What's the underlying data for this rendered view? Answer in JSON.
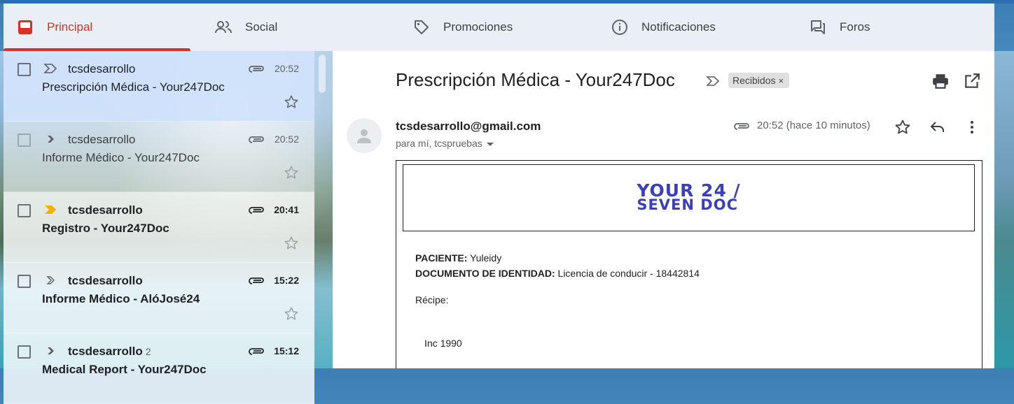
{
  "tabs": [
    {
      "label": "Principal",
      "icon": "inbox-icon",
      "active": true
    },
    {
      "label": "Social",
      "icon": "people-icon",
      "active": false
    },
    {
      "label": "Promociones",
      "icon": "tag-icon",
      "active": false
    },
    {
      "label": "Notificaciones",
      "icon": "info-icon",
      "active": false
    },
    {
      "label": "Foros",
      "icon": "forum-icon",
      "active": false
    }
  ],
  "mail_list": [
    {
      "sender": "tcsdesarrollo",
      "count": "",
      "time": "20:52",
      "subject": "Prescripción Médica - Your247Doc",
      "unread": false,
      "selected": true
    },
    {
      "sender": "tcsdesarrollo",
      "count": "",
      "time": "20:52",
      "subject": "Informe Médico - Your247Doc",
      "unread": false,
      "selected": false
    },
    {
      "sender": "tcsdesarrollo",
      "count": "",
      "time": "20:41",
      "subject": "Registro - Your247Doc",
      "unread": true,
      "selected": false,
      "important": true
    },
    {
      "sender": "tcsdesarrollo",
      "count": "",
      "time": "15:22",
      "subject": "Informe Médico - AlóJosé24",
      "unread": true,
      "selected": false
    },
    {
      "sender": "tcsdesarrollo",
      "count": "2",
      "time": "15:12",
      "subject": "Medical Report - Your247Doc",
      "unread": true,
      "selected": false
    }
  ],
  "reader": {
    "subject": "Prescripción Médica - Your247Doc",
    "label": "Recibidos",
    "label_close": "×",
    "from": "tcsdesarrollo@gmail.com",
    "to": "para mí, tcspruebas",
    "time": "20:52 (hace 10 minutos)",
    "logo_line1": "YOUR 24 /",
    "logo_line2": "SEVEN DOC",
    "patient_label": "PACIENTE:",
    "patient_value": "Yuleidy",
    "doc_label": "DOCUMENTO DE IDENTIDAD:",
    "doc_value": "Licencia de conducir - 18442814",
    "recipe_label": "Récipe:",
    "prescription": "Inc 1990"
  },
  "colors": {
    "accent": "#d93025",
    "logo": "#3b3fb8",
    "selected_row": "#d2e3fc"
  }
}
